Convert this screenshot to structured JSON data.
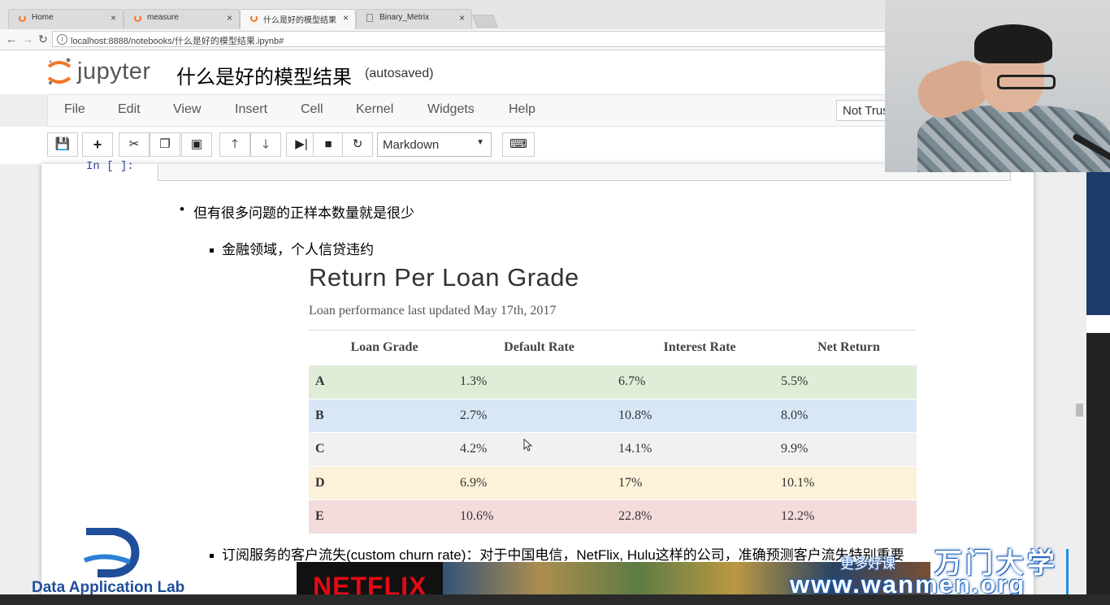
{
  "browser": {
    "tabs": [
      {
        "label": "Home",
        "icon": "jupyter-icon",
        "active": false
      },
      {
        "label": "measure",
        "icon": "jupyter-icon",
        "active": false
      },
      {
        "label": "什么是好的模型结果",
        "icon": "jupyter-icon",
        "active": true
      },
      {
        "label": "Binary_Metrix",
        "icon": "document-icon",
        "active": false
      }
    ],
    "close_glyph": "×",
    "url": "localhost:8888/notebooks/什么是好的模型结果.ipynb#"
  },
  "jupyter": {
    "logo_text": "jupyter",
    "notebook_title": "什么是好的模型结果",
    "save_status": "(autosaved)",
    "menu": [
      "File",
      "Edit",
      "View",
      "Insert",
      "Cell",
      "Kernel",
      "Widgets",
      "Help"
    ],
    "trust_label": "Not Trusted",
    "toolbar_icons": [
      "save-icon",
      "add-cell-icon",
      "cut-icon",
      "copy-icon",
      "paste-icon",
      "move-up-icon",
      "move-down-icon",
      "run-icon",
      "stop-icon",
      "restart-icon",
      "keyboard-icon"
    ],
    "cell_type": "Markdown",
    "accent_color": "#f37626"
  },
  "notebook": {
    "in_prompt": "In [ ]:",
    "bullet_1": "但有很多问题的正样本数量就是很少",
    "sub_bullet_1": "金融领域，个人信贷违约",
    "sub_bullet_2": "订阅服务的客户流失(custom churn rate)：对于中国电信，NetFlix, Hulu这样的公司，准确预测客户流失特别重要"
  },
  "loan_figure": {
    "title": "Return Per Loan Grade",
    "subtitle": "Loan performance last updated May 17th, 2017",
    "headers": [
      "Loan Grade",
      "Default Rate",
      "Interest Rate",
      "Net Return"
    ],
    "rows": [
      {
        "grade": "A",
        "default_rate": "1.3%",
        "interest_rate": "6.7%",
        "net_return": "5.5%",
        "color": "#dfecd6"
      },
      {
        "grade": "B",
        "default_rate": "2.7%",
        "interest_rate": "10.8%",
        "net_return": "8.0%",
        "color": "#d8e7f5"
      },
      {
        "grade": "C",
        "default_rate": "4.2%",
        "interest_rate": "14.1%",
        "net_return": "9.9%",
        "color": "#f1f1f1"
      },
      {
        "grade": "D",
        "default_rate": "6.9%",
        "interest_rate": "17%",
        "net_return": "10.1%",
        "color": "#fcf2d9"
      },
      {
        "grade": "E",
        "default_rate": "10.6%",
        "interest_rate": "22.8%",
        "net_return": "12.2%",
        "color": "#f4dcdc"
      }
    ]
  },
  "overlays": {
    "netflix_logo": "NETFLIX",
    "lab_name": "Data Application Lab",
    "watermark_small": "更多好课",
    "watermark_brand": "万门大学",
    "watermark_url": "www.wanmen.org"
  }
}
